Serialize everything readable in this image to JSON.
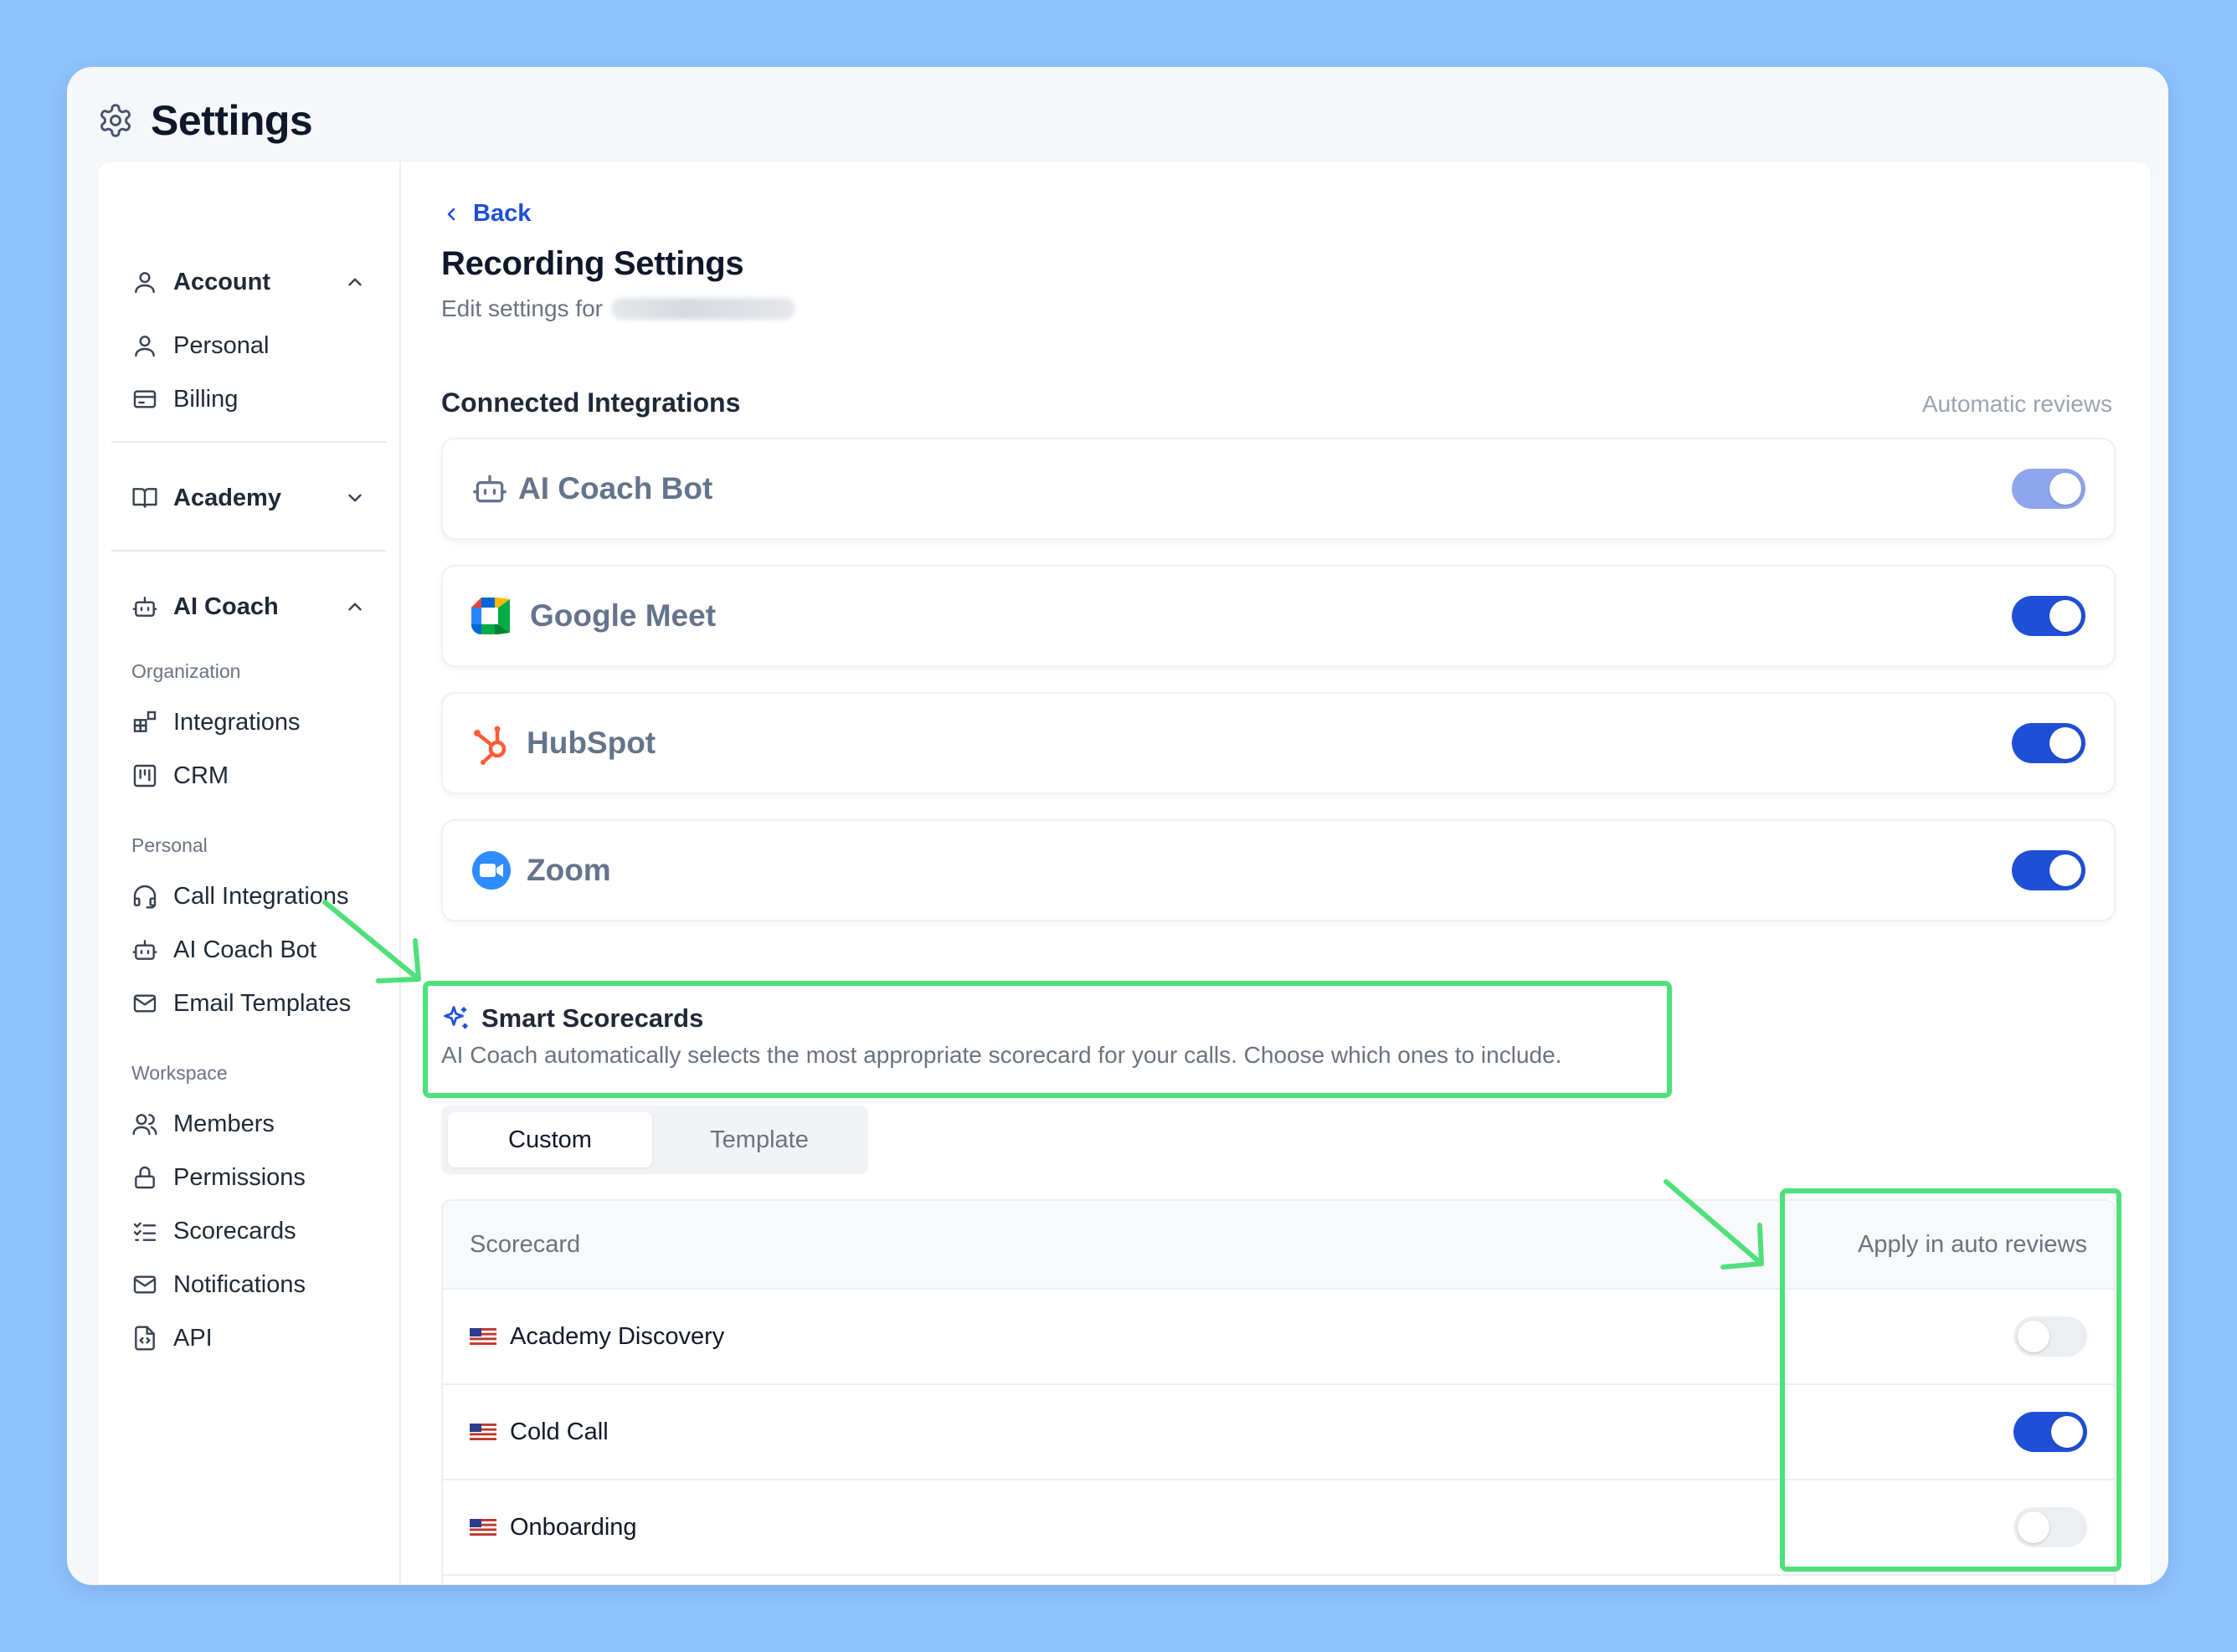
{
  "window": {
    "title": "Settings"
  },
  "sidebar": {
    "account": {
      "label": "Account",
      "items": [
        {
          "label": "Personal"
        },
        {
          "label": "Billing"
        }
      ]
    },
    "academy": {
      "label": "Academy"
    },
    "ai_coach": {
      "label": "AI Coach",
      "groups": {
        "organization": {
          "label": "Organization",
          "items": [
            {
              "label": "Integrations"
            },
            {
              "label": "CRM"
            }
          ]
        },
        "personal": {
          "label": "Personal",
          "items": [
            {
              "label": "Call Integrations"
            },
            {
              "label": "AI Coach Bot"
            },
            {
              "label": "Email Templates"
            }
          ]
        },
        "workspace": {
          "label": "Workspace",
          "items": [
            {
              "label": "Members"
            },
            {
              "label": "Permissions"
            },
            {
              "label": "Scorecards"
            },
            {
              "label": "Notifications"
            },
            {
              "label": "API"
            }
          ]
        }
      }
    }
  },
  "main": {
    "back_label": "Back",
    "title": "Recording Settings",
    "subtitle_prefix": "Edit settings for",
    "integrations_title": "Connected Integrations",
    "integrations_right": "Automatic reviews",
    "integrations": [
      {
        "name": "AI Coach Bot",
        "icon": "robot-icon",
        "enabled": true,
        "state": "disabled-on"
      },
      {
        "name": "Google Meet",
        "icon": "google-meet-icon",
        "enabled": true,
        "state": "on"
      },
      {
        "name": "HubSpot",
        "icon": "hubspot-icon",
        "enabled": true,
        "state": "on"
      },
      {
        "name": "Zoom",
        "icon": "zoom-icon",
        "enabled": true,
        "state": "on"
      }
    ],
    "smart": {
      "title": "Smart Scorecards",
      "description": "AI Coach automatically selects the most appropriate scorecard for your calls. Choose which ones to include."
    },
    "tabs": [
      {
        "label": "Custom",
        "active": true
      },
      {
        "label": "Template",
        "active": false
      }
    ],
    "table": {
      "col_scorecard": "Scorecard",
      "col_apply": "Apply in auto reviews",
      "rows": [
        {
          "name": "Academy Discovery",
          "enabled": false
        },
        {
          "name": "Cold Call",
          "enabled": true
        },
        {
          "name": "Onboarding",
          "enabled": false
        }
      ]
    }
  },
  "colors": {
    "accent": "#1f4fd6",
    "annotation": "#4ee07a",
    "background": "#8fc3fd"
  }
}
